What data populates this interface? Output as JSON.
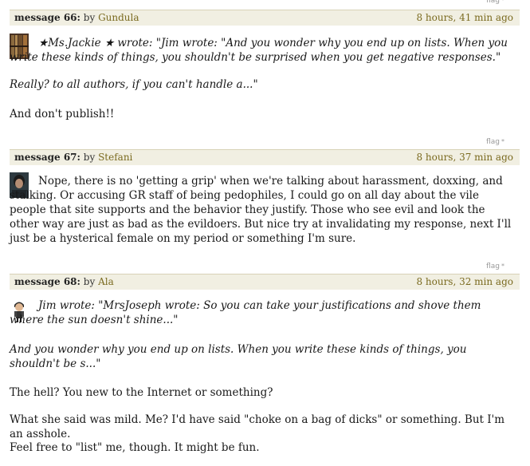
{
  "flag_label": "flag",
  "flag_mark": "*",
  "messages": [
    {
      "label": "message 66:",
      "by": "by",
      "author": "Gundula",
      "time": "8 hours, 41 min ago",
      "paragraphs": [
        "★Ms.Jackie ★ wrote: \"Jim wrote: \"And you wonder why you end up on lists. When you write these kinds of things, you shouldn't be surprised when you get negative responses.\"",
        "Really? to all authors, if you can't handle a...\"",
        "And don't publish!!"
      ]
    },
    {
      "label": "message 67:",
      "by": "by",
      "author": "Stefani",
      "time": "8 hours, 37 min ago",
      "paragraphs": [
        "Nope, there is no 'getting a grip' when we're talking about harassment, doxxing, and stalking. Or accusing GR staff of being pedophiles, I could go on all day about the vile people that site supports and the behavior they justify. Those who see evil and look the other way are just as bad as the evildoers. But nice try at invalidating my response, next I'll just be a hysterical female on my period or something I'm sure."
      ]
    },
    {
      "label": "message 68:",
      "by": "by",
      "author": "Ala",
      "time": "8 hours, 32 min ago",
      "paragraphs": [
        "Jim wrote: \"MrsJoseph wrote: So you can take your justifications and shove them where the sun doesn't shine...\"",
        "And you wonder why you end up on lists. When you write these kinds of things, you shouldn't be s...\"",
        "The hell? You new to the Internet or something?",
        "What she said was mild. Me? I'd have said \"choke on a bag of dicks\" or something. But I'm an asshole.",
        "Feel free to \"list\" me, though. It might be fun."
      ]
    }
  ]
}
